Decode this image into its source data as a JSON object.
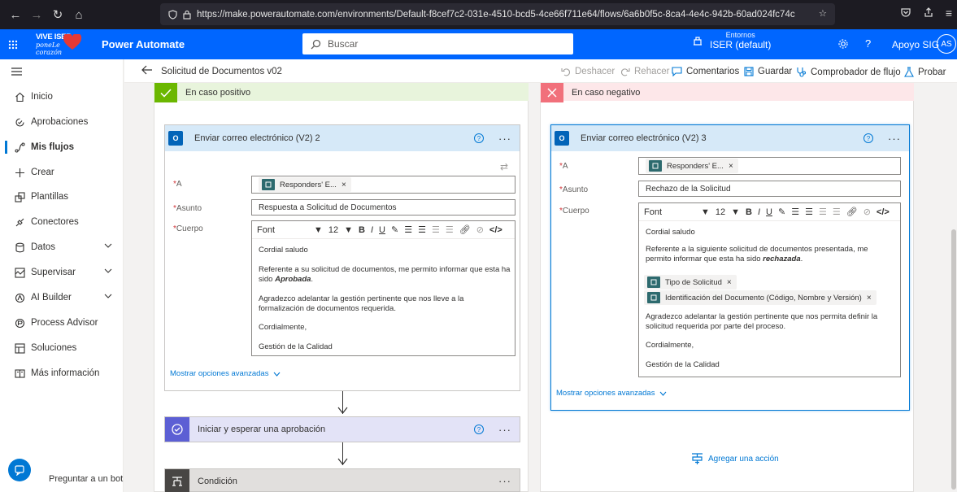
{
  "browser": {
    "url": "https://make.powerautomate.com/environments/Default-f8cef7c2-031e-4510-bcd5-4ce66f711e64/flows/6a6b0f5c-8ca4-4e4c-942b-60ad024fc74c"
  },
  "header": {
    "logo_line1": "VIVE ISER",
    "logo_line2": "poneLe corazón",
    "app_name": "Power Automate",
    "search_placeholder": "Buscar",
    "env_label": "Entornos",
    "env_value": "ISER (default)",
    "help": "?",
    "user_name": "Apoyo SIG",
    "user_initials": "AS"
  },
  "sidebar": {
    "items": [
      {
        "label": "Inicio",
        "icon": "home-icon"
      },
      {
        "label": "Aprobaciones",
        "icon": "approvals-icon"
      },
      {
        "label": "Mis flujos",
        "icon": "flows-icon"
      },
      {
        "label": "Crear",
        "icon": "plus-icon"
      },
      {
        "label": "Plantillas",
        "icon": "templates-icon"
      },
      {
        "label": "Conectores",
        "icon": "connectors-icon"
      },
      {
        "label": "Datos",
        "icon": "data-icon"
      },
      {
        "label": "Supervisar",
        "icon": "monitor-icon"
      },
      {
        "label": "AI Builder",
        "icon": "ai-builder-icon"
      },
      {
        "label": "Process Advisor",
        "icon": "process-advisor-icon"
      },
      {
        "label": "Soluciones",
        "icon": "solutions-icon"
      },
      {
        "label": "Más información",
        "icon": "learn-icon"
      }
    ],
    "bot_label": "Preguntar a un bot d..."
  },
  "cmdbar": {
    "flow_title": "Solicitud de Documentos v02",
    "undo": "Deshacer",
    "redo": "Rehacer",
    "comments": "Comentarios",
    "save": "Guardar",
    "checker": "Comprobador de flujo",
    "test": "Probar"
  },
  "left_branch": {
    "label": "En caso positivo",
    "card": {
      "title": "Enviar correo electrónico (V2) 2",
      "to_label": "A",
      "to_token": "Responders' E...",
      "subject_label": "Asunto",
      "subject_value": "Respuesta a Solicitud de Documentos",
      "body_label": "Cuerpo",
      "font_label": "Font",
      "font_size": "12",
      "body": {
        "greeting": "Cordial saludo",
        "para1": "Referente a su solicitud de documentos, me permito informar que esta ha sido",
        "para1_bold": "Aprobada",
        "para2": "Agradezco adelantar la gestión pertinente que nos lleve a la formalización de documentos requerida.",
        "closing": "Cordialmente,",
        "signature": "Gestión de la Calidad"
      },
      "advanced": "Mostrar opciones avanzadas"
    },
    "approval_title": "Iniciar y esperar una aprobación",
    "condition_title": "Condición"
  },
  "right_branch": {
    "label": "En caso negativo",
    "card": {
      "title": "Enviar correo electrónico (V2) 3",
      "to_label": "A",
      "to_token": "Responders' E...",
      "subject_label": "Asunto",
      "subject_value": "Rechazo de la Solicitud",
      "body_label": "Cuerpo",
      "font_label": "Font",
      "font_size": "12",
      "body": {
        "greeting": "Cordial saludo",
        "para1": "Referente a la siguiente solicitud de documentos presentada, me permito informar que esta ha sido",
        "para1_bold": "rechazada",
        "token1": "Tipo de Solicitud",
        "token2": "Identificación del Documento (Código, Nombre y Versión)",
        "para2": "Agradezco adelantar la gestión pertinente que nos permita definir la solicitud requerida por parte del proceso.",
        "closing": "Cordialmente,",
        "signature": "Gestión de la Calidad"
      },
      "advanced": "Mostrar opciones avanzadas"
    },
    "add_action": "Agregar una acción"
  },
  "colors": {
    "brand_blue": "#0066ff",
    "positive_green": "#6bb700",
    "negative_red": "#f1707b",
    "card_header": "#d6e9f8",
    "approval_purple": "#5c5fd4"
  }
}
